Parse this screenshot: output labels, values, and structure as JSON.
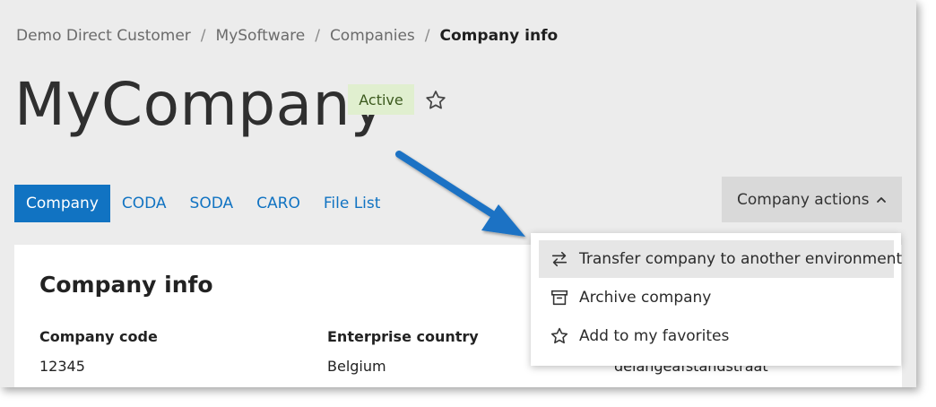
{
  "breadcrumb": {
    "items": [
      "Demo Direct Customer",
      "MySoftware",
      "Companies"
    ],
    "current": "Company info",
    "separator": "/"
  },
  "header": {
    "title": "MyCompany",
    "status_badge": "Active",
    "favorite_icon": "star-outline-icon"
  },
  "tabs": [
    "Company",
    "CODA",
    "SODA",
    "CARO",
    "File List"
  ],
  "active_tab": "Company",
  "actions": {
    "label": "Company actions",
    "chevron_icon": "chevron-up-icon",
    "menu": [
      {
        "label": "Transfer company to another environment",
        "icon": "transfer-arrows-icon"
      },
      {
        "label": "Archive company",
        "icon": "archive-box-icon"
      },
      {
        "label": "Add to my favorites",
        "icon": "star-outline-icon"
      }
    ]
  },
  "card": {
    "title": "Company info",
    "fields": [
      {
        "label": "Company code",
        "value": "12345"
      },
      {
        "label": "Enterprise country",
        "value": "Belgium"
      },
      {
        "label": "",
        "value": "delangeafstandstraat"
      }
    ]
  },
  "colors": {
    "accent": "#1173c2",
    "badge_bg": "#e0efcf",
    "annotation_arrow": "#1a72c4"
  }
}
